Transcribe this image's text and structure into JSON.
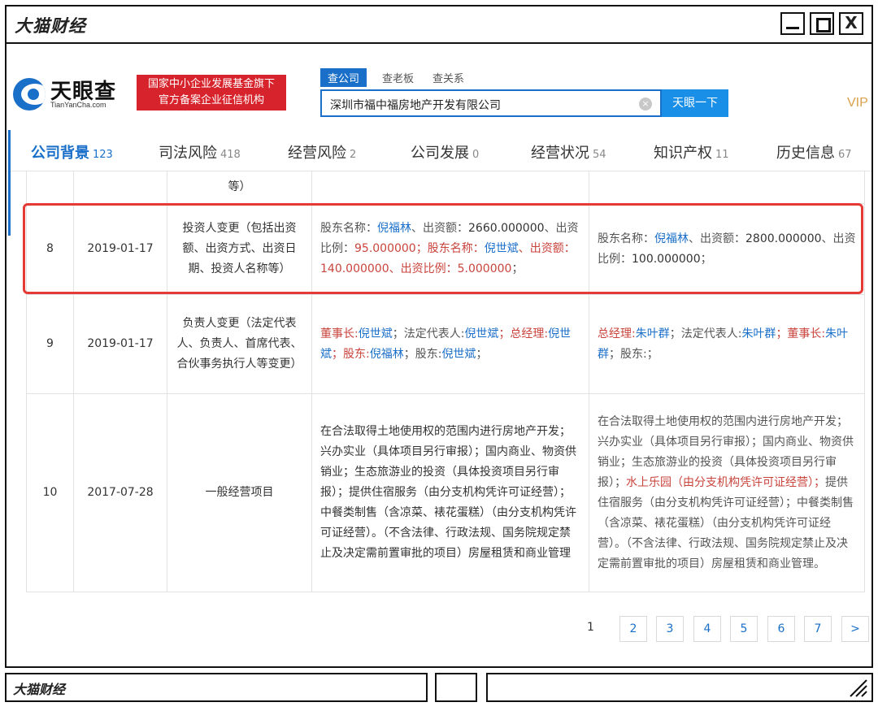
{
  "window": {
    "title": "大猫财经",
    "footer_title": "大猫财经",
    "close_glyph": "X"
  },
  "header": {
    "logo_name": "天眼查",
    "logo_domain": "TianYanCha.com",
    "promo_line1": "国家中小企业发展基金旗下",
    "promo_line2": "官方备案企业征信机构",
    "search_tabs": [
      "查公司",
      "查老板",
      "查关系"
    ],
    "search_value": "深圳市福中福房地产开发有限公司",
    "search_button": "天眼一下",
    "vip": "VIP"
  },
  "tabs": [
    {
      "label": "公司背景",
      "count": "123"
    },
    {
      "label": "司法风险",
      "count": "418"
    },
    {
      "label": "经营风险",
      "count": "2"
    },
    {
      "label": "公司发展",
      "count": "0"
    },
    {
      "label": "经营状况",
      "count": "54"
    },
    {
      "label": "知识产权",
      "count": "11"
    },
    {
      "label": "历史信息",
      "count": "67"
    }
  ],
  "table": {
    "partial_row": {
      "item": "等）"
    },
    "rows": [
      {
        "no": "8",
        "date": "2019-01-17",
        "item": "投资人变更（包括出资额、出资方式、出资日期、投资人名称等）",
        "before": {
          "l1": "股东名称：",
          "v1": "倪福林",
          "l2": "、出资额：",
          "v2": "2660.000000",
          "l3": "、出资比例：",
          "v3": "95.000000",
          "l4": "；股东名称：",
          "v4": "倪世斌",
          "l5": "、出资额：",
          "v5": "140.000000",
          "l6": "、出资比例：",
          "v6": "5.000000",
          "tail": "；"
        },
        "after": {
          "l1": "股东名称：",
          "v1": "倪福林",
          "l2": "、出资额：",
          "v2": "2800.000000",
          "l3": "、出资比例：",
          "v3": "100.000000",
          "tail": "；"
        }
      },
      {
        "no": "9",
        "date": "2019-01-17",
        "item": "负责人变更（法定代表人、负责人、首席代表、合伙事务执行人等变更）",
        "before": {
          "l1": "董事长:",
          "v1": "倪世斌",
          "l2": "；法定代表人:",
          "v2": "倪世斌",
          "l3": "；总经理:",
          "v3": "倪世斌",
          "l4": "；股东:",
          "v4": "倪福林",
          "l5": "；股东:",
          "v5": "倪世斌",
          "tail": "；"
        },
        "after": {
          "l1": "总经理:",
          "v1": "朱叶群",
          "l2": "；法定代表人:",
          "v2": "朱叶群",
          "l3": "；董事长:",
          "v3": "朱叶群",
          "tail": "；股东:；"
        }
      },
      {
        "no": "10",
        "date": "2017-07-28",
        "item": "一般经营项目",
        "before": "在合法取得土地使用权的范围内进行房地产开发；兴办实业（具体项目另行审报）；国内商业、物资供销业；生态旅游业的投资（具体投资项目另行审报）；提供住宿服务（由分支机构凭许可证经营）；中餐类制售（含凉菜、裱花蛋糕）（由分支机构凭许可证经营）。（不含法律、行政法规、国务院规定禁止及决定需前置审批的项目）房屋租赁和商业管理",
        "after": {
          "p1": "在合法取得土地使用权的范围内进行房地产开发；兴办实业（具体项目另行审报）；国内商业、物资供销业；生态旅游业的投资（具体投资项目另行审报）；",
          "p2": "水上乐园（由分支机构凭许可证经营）；",
          "p3": "提供住宿服务（由分支机构凭许可证经营）；中餐类制售（含凉菜、裱花蛋糕）（由分支机构凭许可证经营）。（不含法律、行政法规、国务院规定禁止及决定需前置审批的项目）房屋租赁和商业管理。"
        }
      }
    ]
  },
  "pagination": {
    "current": "1",
    "pages": [
      "2",
      "3",
      "4",
      "5",
      "6",
      "7"
    ],
    "next": ">"
  },
  "colors": {
    "brand_blue": "#1a6fc9",
    "promo_red": "#d7232b",
    "highlight_red": "#e53935",
    "change_red": "#c9443c"
  },
  "icons": [
    "tianyancha-logo-icon",
    "clear-icon",
    "minimize-icon",
    "maximize-icon",
    "close-icon",
    "resize-grip-icon"
  ]
}
